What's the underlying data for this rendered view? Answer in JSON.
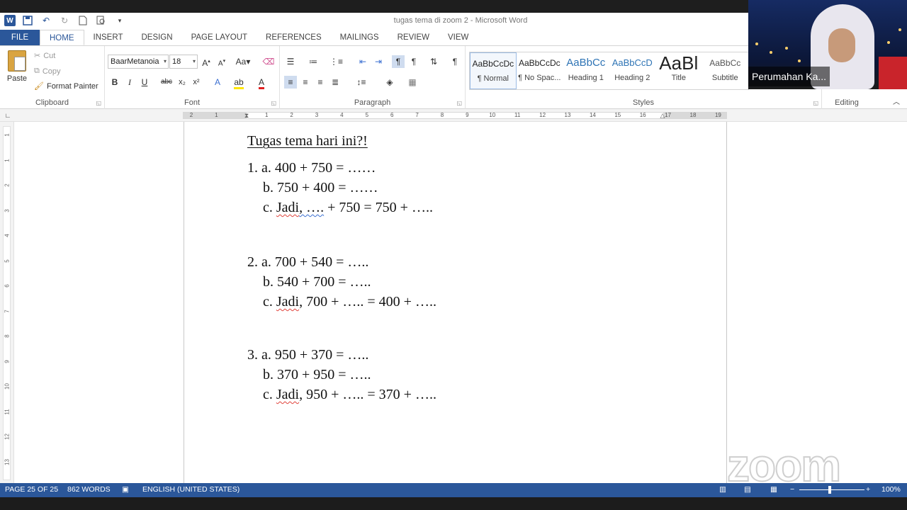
{
  "window": {
    "title": "tugas tema di zoom 2 - Microsoft Word"
  },
  "tabs": [
    "FILE",
    "HOME",
    "INSERT",
    "DESIGN",
    "PAGE LAYOUT",
    "REFERENCES",
    "MAILINGS",
    "REVIEW",
    "VIEW"
  ],
  "ribbon": {
    "clipboard": {
      "paste": "Paste",
      "cut": "Cut",
      "copy": "Copy",
      "format_painter": "Format Painter",
      "label": "Clipboard"
    },
    "font": {
      "name": "BaarMetanoia",
      "size": "18",
      "label": "Font"
    },
    "paragraph": {
      "label": "Paragraph"
    },
    "styles": {
      "label": "Styles",
      "items": [
        {
          "sample": "AaBbCcDc",
          "name": "¶ Normal"
        },
        {
          "sample": "AaBbCcDc",
          "name": "¶ No Spac..."
        },
        {
          "sample": "AaBbCc",
          "name": "Heading 1"
        },
        {
          "sample": "AaBbCcD",
          "name": "Heading 2"
        },
        {
          "sample": "AaBl",
          "name": "Title"
        },
        {
          "sample": "AaBbCc",
          "name": "Subtitle"
        }
      ]
    },
    "editing": {
      "label": "Editing"
    }
  },
  "ruler": {
    "numbers": [
      "2",
      "1",
      "",
      "1",
      "2",
      "3",
      "4",
      "5",
      "6",
      "7",
      "8",
      "9",
      "10",
      "11",
      "12",
      "13",
      "14",
      "15",
      "16",
      "17",
      "18",
      "19"
    ]
  },
  "vruler": [
    "1",
    "1",
    "2",
    "3",
    "4",
    "5",
    "6",
    "7",
    "8",
    "9",
    "10",
    "11",
    "12",
    "13"
  ],
  "document": {
    "title": "Tugas tema hari ini?!",
    "q1": {
      "a": "1. a. 400 + 750 = ……",
      "b": "b. 750 + 400 = ……",
      "c_pre": "c. ",
      "c_jadi": "Jadi",
      "c_dots": ", ….",
      "c_post": " + 750 = 750 + ….."
    },
    "q2": {
      "a": "2. a. 700 + 540 = …..",
      "b": "b. 540 + 700 = …..",
      "c_pre": "c. ",
      "c_jadi": "Jadi",
      "c_post": ", 700 + ….. = 400 + ….."
    },
    "q3": {
      "a": "3. a. 950 + 370 = …..",
      "b": "b. 370 + 950 = …..",
      "c_pre": "c. ",
      "c_jadi": "Jadi",
      "c_post": ", 950 + ….. = 370 + ….."
    }
  },
  "status": {
    "page": "PAGE 25 OF 25",
    "words": "862 WORDS",
    "language": "ENGLISH (UNITED STATES)",
    "zoom": "100%"
  },
  "webcam": {
    "participant_name": "Perumahan Ka..."
  },
  "watermark": "zoom",
  "colors": {
    "word_blue": "#2b579a",
    "spell_red": "#e0413a",
    "grammar_blue": "#3b6fd1"
  }
}
